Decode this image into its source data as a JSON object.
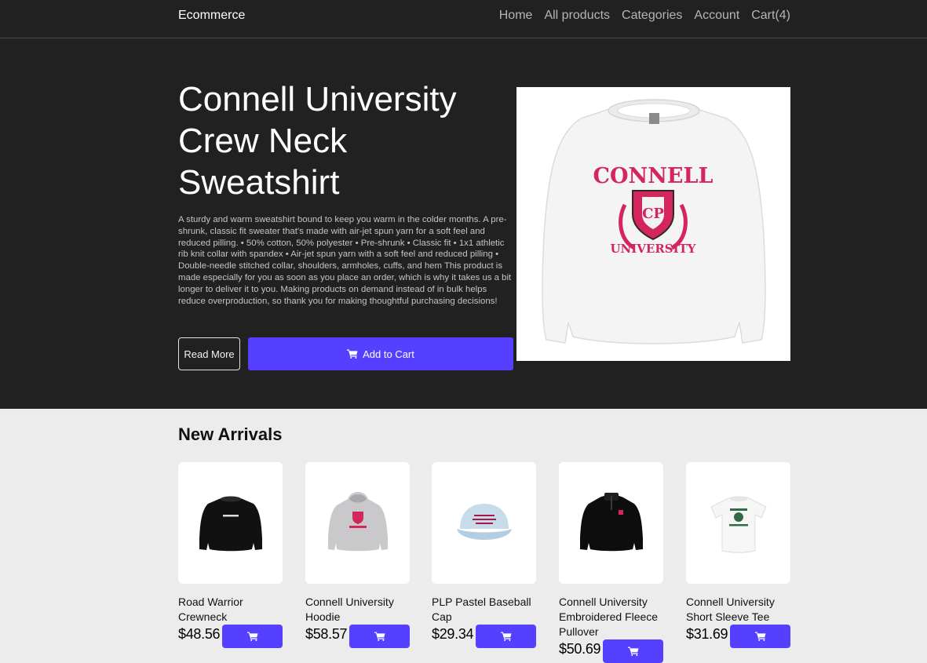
{
  "navbar": {
    "brand": "Ecommerce",
    "links": [
      "Home",
      "All products",
      "Categories",
      "Account",
      "Cart(4)"
    ]
  },
  "hero": {
    "title": "Connell University Crew Neck Sweatshirt",
    "description": "A sturdy and warm sweatshirt bound to keep you warm in the colder months. A pre-shrunk, classic fit sweater that's made with air-jet spun yarn for a soft feel and reduced pilling. • 50% cotton, 50% polyester • Pre-shrunk • Classic fit • 1x1 athletic rib knit collar with spandex • Air-jet spun yarn with a soft feel and reduced pilling • Double-needle stitched collar, shoulders, armholes, cuffs, and hem This product is made especially for you as soon as you place an order, which is why it takes us a bit longer to deliver it to you. Making products on demand instead of in bulk helps reduce overproduction, so thank you for making thoughtful purchasing decisions!",
    "read_more_label": "Read More",
    "add_to_cart_label": "Add to Cart",
    "image_icon": "sweatshirt-image",
    "image_text_top": "CONNELL",
    "image_text_bottom": "UNIVERSITY",
    "image_crest_letters": "CP"
  },
  "new_arrivals": {
    "title": "New Arrivals",
    "products": [
      {
        "name": "Road Warrior Crewneck",
        "price": "$48.56",
        "icon": "black-crewneck-image"
      },
      {
        "name": "Connell University Hoodie",
        "price": "$58.57",
        "icon": "grey-hoodie-image"
      },
      {
        "name": "PLP Pastel Baseball Cap",
        "price": "$29.34",
        "icon": "baseball-cap-image"
      },
      {
        "name": "Connell University Embroidered Fleece Pullover",
        "price": "$50.69",
        "icon": "black-fleece-image"
      },
      {
        "name": "Connell University Short Sleeve Tee",
        "price": "$31.69",
        "icon": "white-tee-image"
      }
    ]
  },
  "colors": {
    "header_bg": "#212121",
    "accent": "#5640ff",
    "page_bg": "#ececec",
    "crest_red": "#d4255c"
  },
  "icons": {
    "cart": "cart-icon"
  }
}
